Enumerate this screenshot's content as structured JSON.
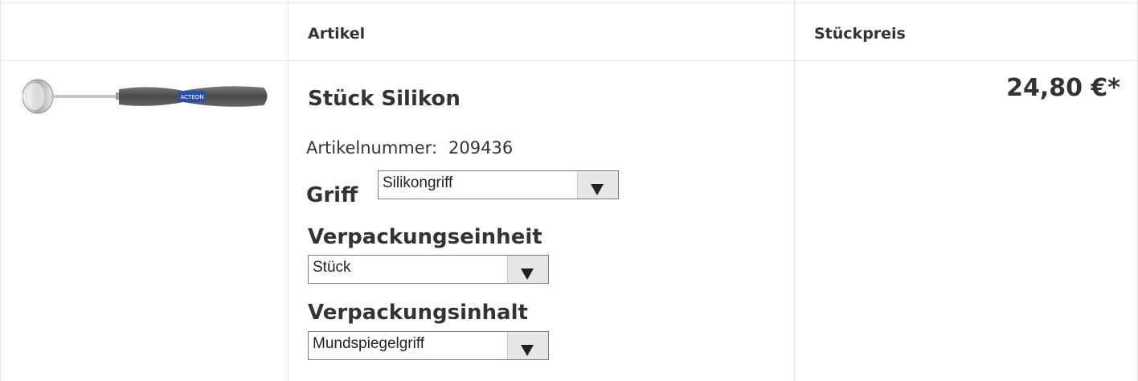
{
  "table": {
    "headers": {
      "article": "Artikel",
      "unit_price": "Stückpreis"
    }
  },
  "product": {
    "image_icon": "dental-mirror-icon",
    "brand_mark": "ACTEON",
    "title": "Stück Silikon",
    "article_number_label": "Artikelnummer:",
    "article_number": "209436",
    "price": "24,80 €*"
  },
  "options": {
    "griff": {
      "label": "Griff",
      "value": "Silikongriff"
    },
    "verpackungseinheit": {
      "label": "Verpackungseinheit",
      "value": "Stück"
    },
    "verpackungsinhalt": {
      "label": "Verpackungsinhalt",
      "value": "Mundspiegelgriff"
    }
  },
  "colors": {
    "border": "#e4e4e4",
    "text": "#333333",
    "handle": "#555555",
    "handle_band": "#2b4fa8"
  }
}
